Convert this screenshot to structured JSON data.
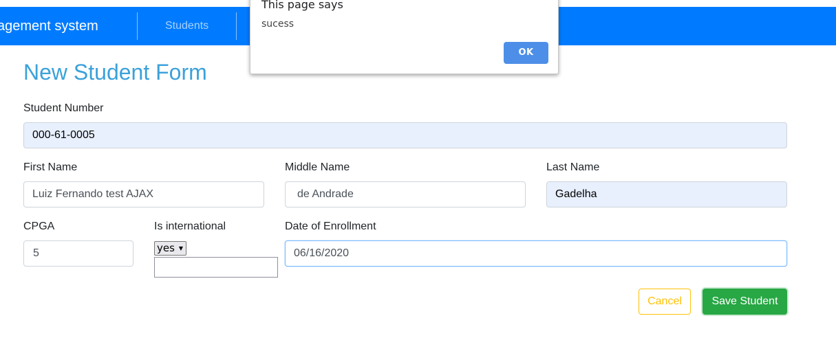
{
  "navbar": {
    "brand": "agement system",
    "link_students": "Students"
  },
  "form": {
    "title": "New Student Form",
    "student_number": {
      "label": "Student Number",
      "value": "000-61-0005"
    },
    "first_name": {
      "label": "First Name",
      "value": "Luiz Fernando test AJAX"
    },
    "middle_name": {
      "label": "Middle Name",
      "value": "de Andrade"
    },
    "last_name": {
      "label": "Last Name",
      "value": "Gadelha"
    },
    "cpga": {
      "label": "CPGA",
      "value": "5"
    },
    "is_international": {
      "label": "Is international",
      "selected": "yes"
    },
    "date_of_enrollment": {
      "label": "Date of Enrollment",
      "value": "06/16/2020"
    },
    "cancel_label": "Cancel",
    "save_label": "Save Student"
  },
  "dialog": {
    "title": "This page says",
    "message": "sucess",
    "ok_label": "OK"
  },
  "colors": {
    "navbar": "#007bff",
    "title": "#3ba1da",
    "cancel": "#ffc107",
    "save": "#28a745",
    "dialog_ok": "#4d8fe8",
    "autofill": "#e8f0fe"
  }
}
